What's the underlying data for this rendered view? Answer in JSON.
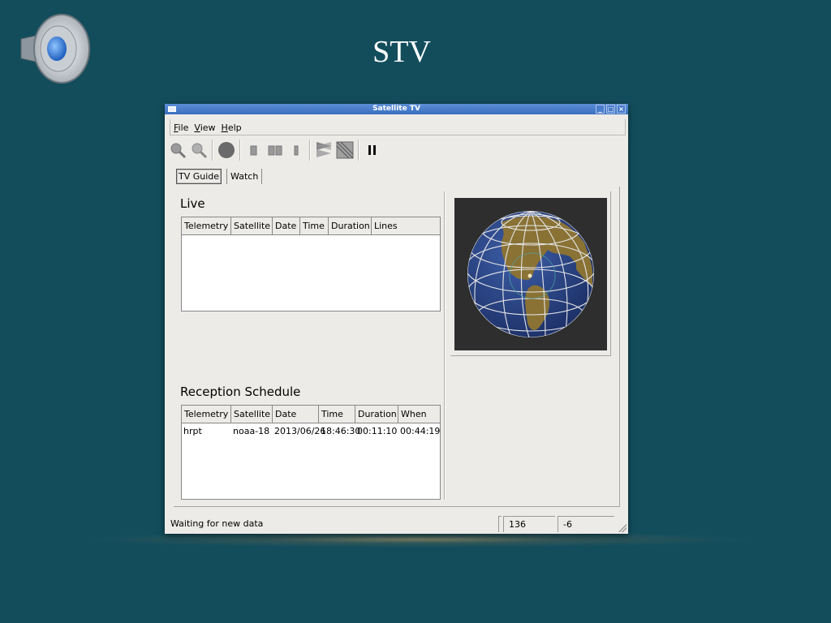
{
  "slide": {
    "title": "STV"
  },
  "window": {
    "title": "Satellite TV",
    "controls": [
      "_",
      "□",
      "×"
    ]
  },
  "menu": [
    "File",
    "View",
    "Help"
  ],
  "toolbar": {
    "buttons": [
      "zoom-in-icon",
      "zoom-out-icon",
      "globe-icon",
      "single-view-icon",
      "dual-view-icon",
      "narrow-view-icon",
      "layers-icon",
      "pattern-icon",
      "pause-icon"
    ]
  },
  "tabs": [
    "TV Guide",
    "Watch"
  ],
  "live": {
    "title": "Live",
    "columns": [
      "Telemetry",
      "Satellite",
      "Date",
      "Time",
      "Duration",
      "Lines"
    ],
    "rows": []
  },
  "schedule": {
    "title": "Reception Schedule",
    "columns": [
      "Telemetry",
      "Satellite",
      "Date",
      "Time",
      "Duration",
      "When"
    ],
    "rows": [
      [
        "hrpt",
        "noaa-18",
        "2013/06/26",
        "18:46:30",
        "00:11:10",
        "00:44:19"
      ]
    ]
  },
  "status": {
    "message": "Waiting for new data",
    "field1": "136",
    "field2": "-6"
  },
  "colors": {
    "slide_background": "#134d5c",
    "window_background": "#edebe8",
    "titlebar": "#3a6fbf",
    "globe_ocean": "#27407e",
    "globe_land": "#8a7235"
  }
}
